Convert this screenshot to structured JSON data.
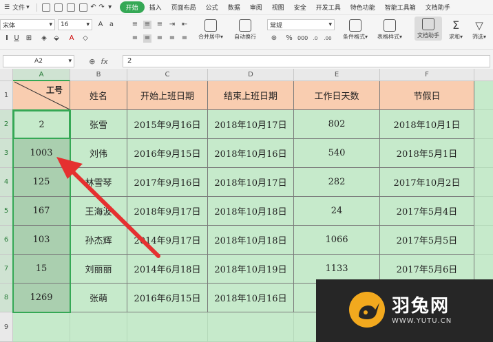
{
  "menubar": {
    "file": "文件",
    "tabs": [
      "开始",
      "插入",
      "页面布局",
      "公式",
      "数据",
      "审阅",
      "视图",
      "安全",
      "开发工具",
      "特色功能",
      "智能工具箱",
      "文档助手"
    ],
    "active_tab": "开始"
  },
  "ribbon": {
    "font_name": "宋体",
    "font_size": "16",
    "number_format": "常规",
    "merge_center": "合并居中",
    "wrap_text": "自动换行",
    "conditional_format": "条件格式",
    "table_style": "表格样式",
    "doc_assistant": "文档助手",
    "sum": "求和",
    "filter": "筛选"
  },
  "formula_bar": {
    "name_box": "A2",
    "fx_label": "fx",
    "value": "2"
  },
  "sheet": {
    "columns": [
      "A",
      "B",
      "C",
      "D",
      "E",
      "F"
    ],
    "rows": [
      "1",
      "2",
      "3",
      "4",
      "5",
      "6",
      "7",
      "8",
      "9"
    ],
    "header": {
      "a1": "工号",
      "b": "姓名",
      "c": "开始上班日期",
      "d": "结束上班日期",
      "e": "工作日天数",
      "f": "节假日"
    },
    "data": [
      [
        "2",
        "张雪",
        "2015年9月16日",
        "2018年10月17日",
        "802",
        "2018年10月1日"
      ],
      [
        "1003",
        "刘伟",
        "2016年9月15日",
        "2018年10月16日",
        "540",
        "2018年5月1日"
      ],
      [
        "125",
        "林雪琴",
        "2017年9月16日",
        "2018年10月17日",
        "282",
        "2017年10月2日"
      ],
      [
        "167",
        "王海波",
        "2018年9月17日",
        "2018年10月18日",
        "24",
        "2017年5月4日"
      ],
      [
        "103",
        "孙杰辉",
        "2014年9月17日",
        "2018年10月18日",
        "1066",
        "2017年5月5日"
      ],
      [
        "15",
        "刘丽丽",
        "2014年6月18日",
        "2018年10月19日",
        "1133",
        "2017年5月6日"
      ],
      [
        "1269",
        "张萌",
        "2016年6月15日",
        "2018年10月16日",
        "",
        ""
      ]
    ]
  },
  "watermark": {
    "name": "羽兔网",
    "url": "WWW.YUTU.CN",
    "color": "#f2a91e"
  },
  "colors": {
    "accent": "#35a855",
    "header_fill": "#f9cdb0",
    "cell_fill": "#c6eacb",
    "arrow": "#e53030"
  }
}
